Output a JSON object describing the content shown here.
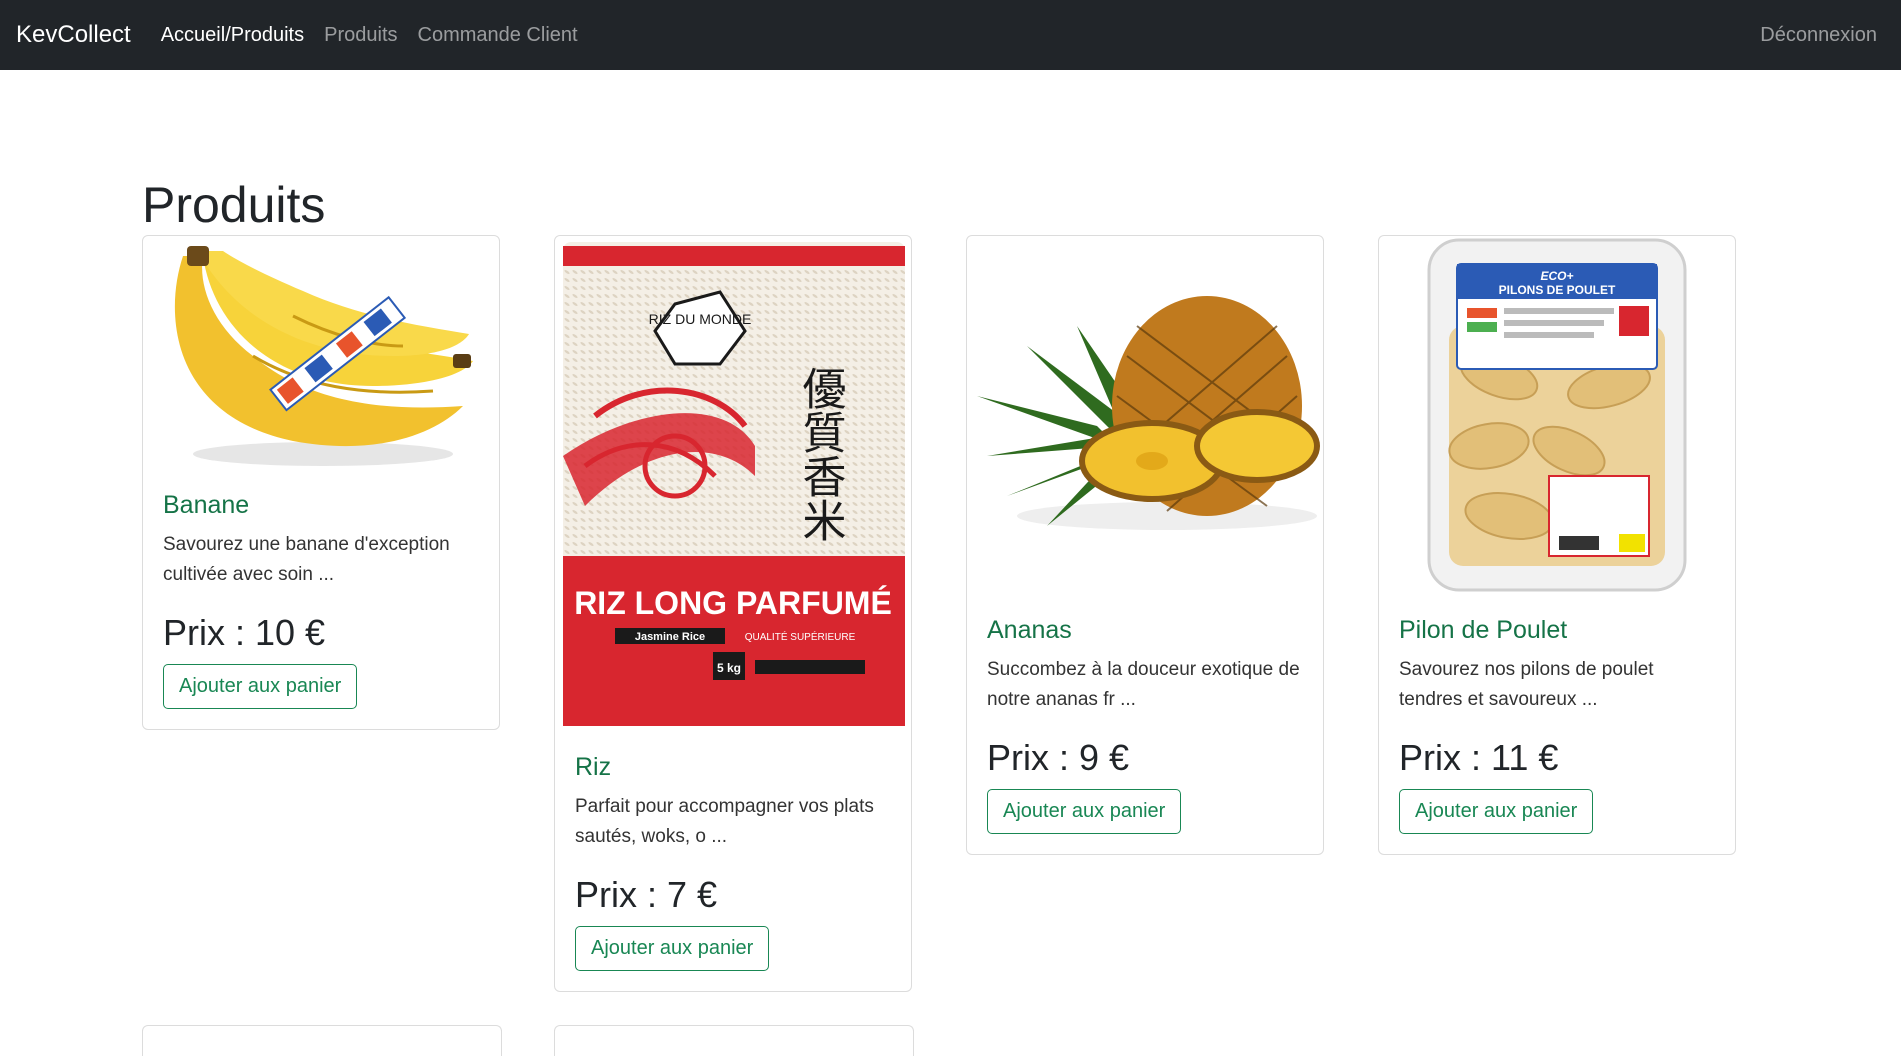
{
  "navbar": {
    "brand": "KevCollect",
    "links": [
      {
        "label": "Accueil/Produits"
      },
      {
        "label": "Produits"
      },
      {
        "label": "Commande Client"
      }
    ],
    "logout": "Déconnexion"
  },
  "page": {
    "title": "Produits"
  },
  "products": [
    {
      "name": "Banane",
      "description": "Savourez une banane d'exception cultivée avec soin ...",
      "price": "Prix : 10 €",
      "button": "Ajouter aux panier"
    },
    {
      "name": "Riz",
      "description": "Parfait pour accompagner vos plats sautés, woks, o ...",
      "price": "Prix : 7 €",
      "button": "Ajouter aux panier",
      "package": {
        "logo": "RIZ DU MONDE",
        "chinese": "優質香米",
        "title": "RIZ LONG PARFUMÉ",
        "subtitle": "Jasmine Rice",
        "quality": "QUALITÉ SUPÉRIEURE",
        "weight": "5 kg"
      }
    },
    {
      "name": "Ananas",
      "description": "Succombez à la douceur exotique de notre ananas fr ...",
      "price": "Prix : 9 €",
      "button": "Ajouter aux panier"
    },
    {
      "name": "Pilon de Poulet",
      "description": "Savourez nos pilons de poulet tendres et savoureux ...",
      "price": "Prix : 11 €",
      "button": "Ajouter aux panier",
      "package": {
        "brand": "ECO+",
        "title": "PILONS DE POULET"
      }
    }
  ]
}
